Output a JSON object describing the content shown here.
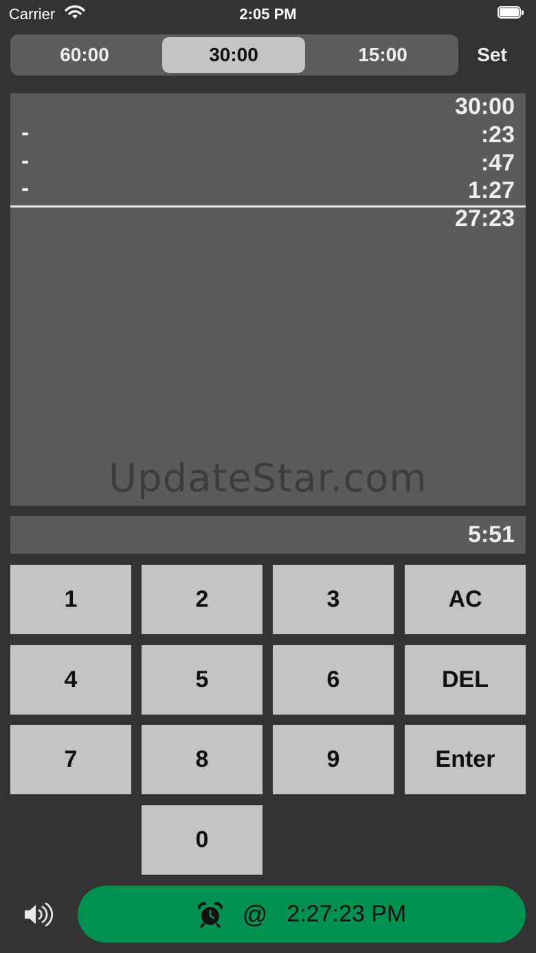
{
  "status_bar": {
    "carrier": "Carrier",
    "time": "2:05 PM"
  },
  "segments": {
    "items": [
      "60:00",
      "30:00",
      "15:00"
    ],
    "selected": "30:00"
  },
  "set_label": "Set",
  "tape": {
    "rows": [
      {
        "sign": "",
        "value": "30:00"
      },
      {
        "sign": "-",
        "value": ":23"
      },
      {
        "sign": "-",
        "value": ":47"
      },
      {
        "sign": "-",
        "value": "1:27"
      }
    ],
    "total": "27:23",
    "watermark": "UpdateStar.com"
  },
  "entry": {
    "value": "5:51"
  },
  "keypad": {
    "k1": "1",
    "k2": "2",
    "k3": "3",
    "ac": "AC",
    "k4": "4",
    "k5": "5",
    "k6": "6",
    "del": "DEL",
    "k7": "7",
    "k8": "8",
    "k9": "9",
    "enter": "Enter",
    "k0": "0"
  },
  "alarm": {
    "at": "@",
    "time": "2:27:23 PM",
    "icon": "alarm-clock-icon"
  },
  "sound_icon": "speaker-icon",
  "colors": {
    "background": "#333333",
    "panel": "#5b5b5b",
    "key": "#c4c4c4",
    "alarm": "#009150"
  }
}
